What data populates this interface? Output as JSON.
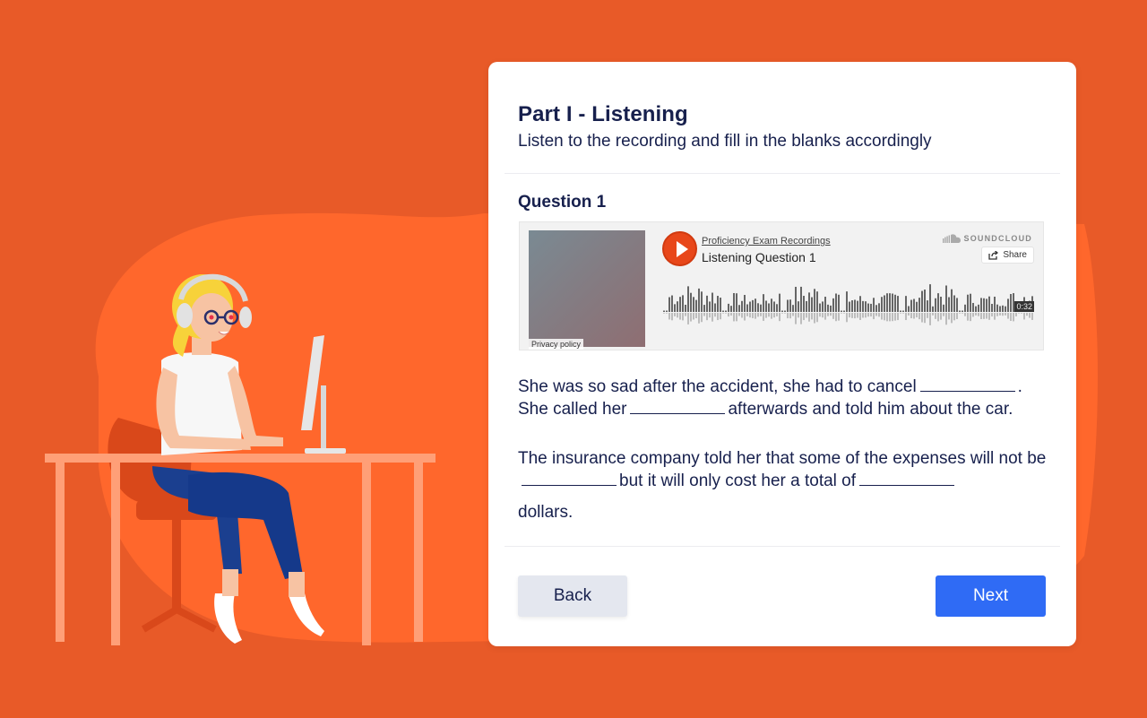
{
  "header": {
    "title": "Part I - Listening",
    "subtitle": "Listen to the recording and fill in the blanks accordingly"
  },
  "question": {
    "label": "Question 1",
    "line1_a": "She was so sad after the accident, she had to cancel",
    "line1_b": ".",
    "line2_a": "She called her",
    "line2_b": "afterwards and told him about the car.",
    "para2_a": "The insurance company told her that some of the expenses will not be",
    "para2_b": "but it will only cost her a total of",
    "para2_c": "dollars."
  },
  "player": {
    "uploader": "Proficiency Exam Recordings",
    "track_title": "Listening Question 1",
    "brand": "SOUNDCLOUD",
    "share_label": "Share",
    "duration": "0:32",
    "privacy": "Privacy policy",
    "play_icon": "play-icon",
    "accent": "#E8471A"
  },
  "buttons": {
    "back": "Back",
    "next": "Next"
  },
  "colors": {
    "background": "#E85A28",
    "primary": "#2F6BF5",
    "text": "#17204D"
  }
}
